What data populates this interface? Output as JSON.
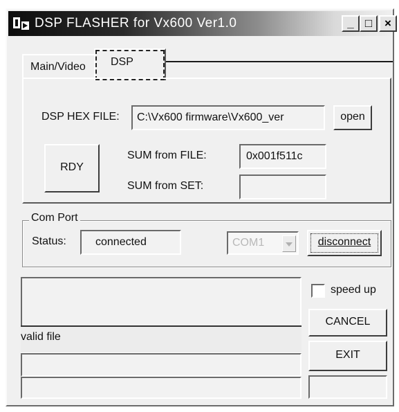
{
  "window": {
    "title": "DSP FLASHER for Vx600  Ver1.0",
    "controls": {
      "minimize": "_",
      "maximize": "□",
      "close": "×"
    }
  },
  "tabs": [
    {
      "label": "Main/Video",
      "selected": false
    },
    {
      "label": "DSP",
      "selected": true
    }
  ],
  "dsp": {
    "hex_file_label": "DSP HEX FILE:",
    "hex_file_value": "C:\\Vx600 firmware\\Vx600_ver",
    "open_label": "open",
    "rdy_label": "RDY",
    "sum_file_label": "SUM from FILE:",
    "sum_file_value": "0x001f511c",
    "sum_set_label": "SUM from SET:",
    "sum_set_value": ""
  },
  "com_port": {
    "group_label": "Com Port",
    "status_label": "Status:",
    "status_value": "connected",
    "port_value": "COM1",
    "disconnect_label": "disconnect"
  },
  "log": {
    "line1": "",
    "line2": "valid file",
    "line3": "",
    "line4": ""
  },
  "actions": {
    "speed_up_label": "speed up",
    "speed_up_checked": false,
    "cancel_label": "CANCEL",
    "exit_label": "EXIT",
    "status_box": ""
  }
}
